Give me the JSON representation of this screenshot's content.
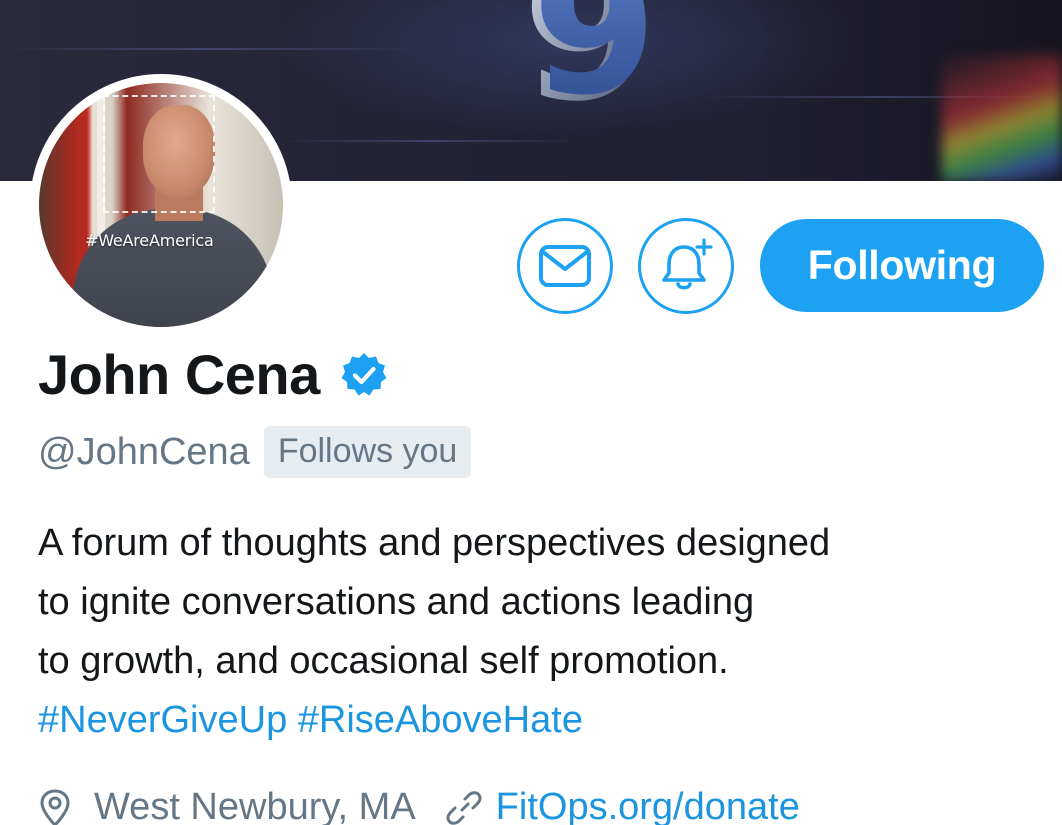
{
  "banner": {
    "art_digit": "9"
  },
  "avatar": {
    "overlay_tag": "#WeAreAmerica"
  },
  "actions": {
    "message_icon": "envelope-icon",
    "notify_icon": "bell-plus-icon",
    "follow_label": "Following"
  },
  "profile": {
    "name": "John Cena",
    "verified_icon": "verified-badge-icon",
    "handle": "@JohnCena",
    "follows_you": "Follows you",
    "bio_lines": [
      "A forum of thoughts and perspectives designed",
      "to ignite conversations and actions leading",
      "to growth, and occasional self promotion."
    ],
    "hashtags": [
      "#NeverGiveUp",
      "#RiseAboveHate"
    ],
    "location_icon": "location-pin-icon",
    "location": "West Newbury, MA",
    "link_icon": "link-icon",
    "website": "FitOps.org/donate"
  },
  "colors": {
    "accent": "#1da1f2",
    "link": "#1b95e0",
    "text_primary": "#14171a",
    "text_secondary": "#657786",
    "badge_bg": "#e6ecf0"
  }
}
